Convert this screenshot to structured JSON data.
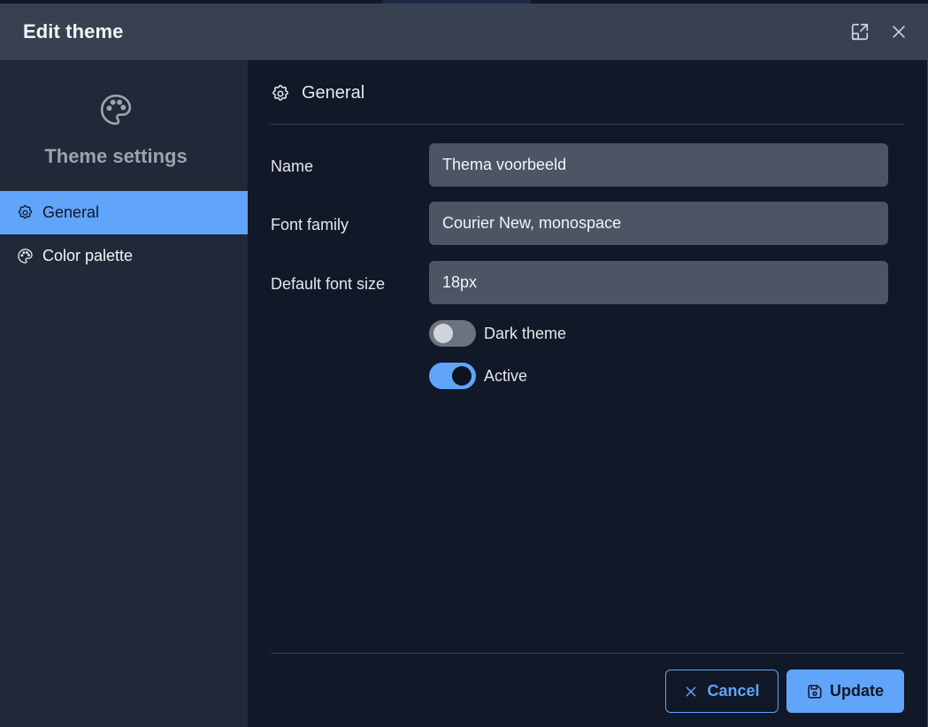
{
  "dialog": {
    "title": "Edit theme",
    "maximize_icon": "maximize-icon",
    "close_icon": "close-icon"
  },
  "sidebar": {
    "icon": "palette-icon",
    "title": "Theme settings",
    "items": [
      {
        "label": "General",
        "icon": "gear-icon",
        "active": true
      },
      {
        "label": "Color palette",
        "icon": "palette-icon",
        "active": false
      }
    ]
  },
  "main": {
    "section_title": "General",
    "section_icon": "gear-icon",
    "fields": {
      "name": {
        "label": "Name",
        "value": "Thema voorbeeld"
      },
      "font_family": {
        "label": "Font family",
        "value": "Courier New, monospace"
      },
      "font_size": {
        "label": "Default font size",
        "value": "18px"
      }
    },
    "toggles": {
      "dark_theme": {
        "label": "Dark theme",
        "checked": false
      },
      "active": {
        "label": "Active",
        "checked": true
      }
    }
  },
  "footer": {
    "cancel_label": "Cancel",
    "update_label": "Update"
  },
  "colors": {
    "accent": "#60a5fa",
    "header_bg": "#374151",
    "sidebar_bg": "#1f2937",
    "content_bg": "#111827",
    "input_bg": "#4b5563"
  }
}
